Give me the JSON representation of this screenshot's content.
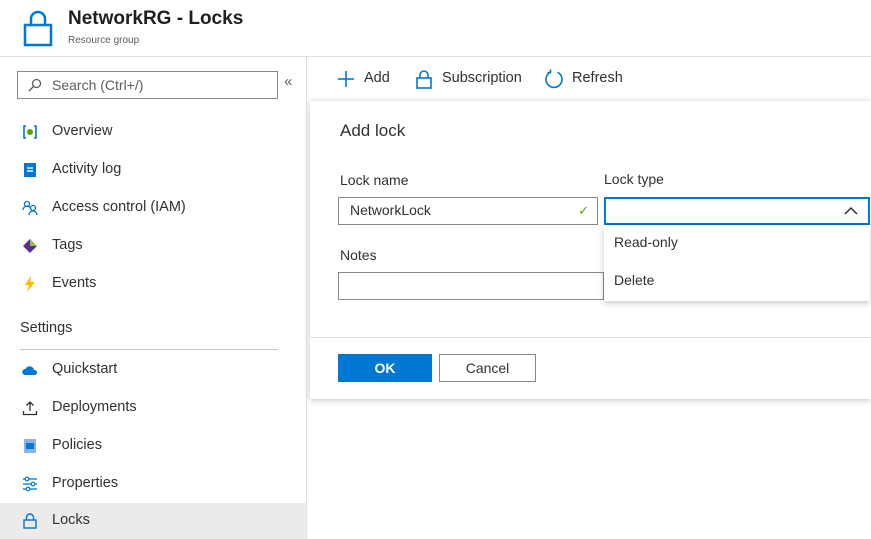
{
  "header": {
    "title": "NetworkRG - Locks",
    "subtitle": "Resource group",
    "icon": "lock-icon"
  },
  "sidebar": {
    "search_placeholder": "Search (Ctrl+/)",
    "collapse_label": "«",
    "items": [
      {
        "label": "Overview",
        "icon": "overview-icon"
      },
      {
        "label": "Activity log",
        "icon": "activity-log-icon"
      },
      {
        "label": "Access control (IAM)",
        "icon": "iam-icon"
      },
      {
        "label": "Tags",
        "icon": "tag-icon"
      },
      {
        "label": "Events",
        "icon": "lightning-icon"
      }
    ],
    "section_title": "Settings",
    "settings_items": [
      {
        "label": "Quickstart",
        "icon": "cloud-icon"
      },
      {
        "label": "Deployments",
        "icon": "upload-icon"
      },
      {
        "label": "Policies",
        "icon": "policy-icon"
      },
      {
        "label": "Properties",
        "icon": "properties-icon"
      },
      {
        "label": "Locks",
        "icon": "lock-icon",
        "active": true
      }
    ]
  },
  "toolbar": {
    "add_label": "Add",
    "subscription_label": "Subscription",
    "refresh_label": "Refresh"
  },
  "panel": {
    "title": "Add lock",
    "lock_name_label": "Lock name",
    "lock_name_value": "NetworkLock",
    "lock_type_label": "Lock type",
    "lock_type_value": "",
    "lock_type_options": [
      "Read-only",
      "Delete"
    ],
    "notes_label": "Notes",
    "notes_value": "",
    "ok_label": "OK",
    "cancel_label": "Cancel"
  },
  "colors": {
    "accent": "#0078d4",
    "valid_check": "#57a300",
    "active_item_bg": "#edebe9"
  }
}
